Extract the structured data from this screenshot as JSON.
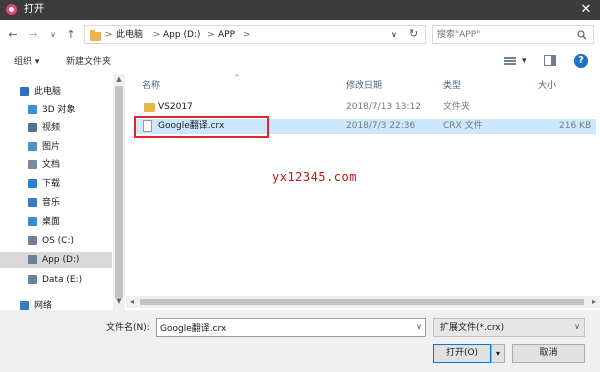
{
  "window": {
    "title": "打开",
    "close_glyph": "✕"
  },
  "nav": {
    "back": "←",
    "forward": "→",
    "recent": "∨",
    "up": "↑"
  },
  "breadcrumb": {
    "items": [
      "此电脑",
      "App (D:)",
      "APP"
    ],
    "separator": ">"
  },
  "address": {
    "dropdown": "∨",
    "refresh": "↻"
  },
  "search": {
    "placeholder": "搜索\"APP\""
  },
  "toolbar": {
    "organize": "组织 ▾",
    "new_folder": "新建文件夹",
    "view_dropdown": "▾",
    "help": "?"
  },
  "sidebar": {
    "items": [
      {
        "label": "此电脑",
        "icon": "computer-icon",
        "color": "#2d6fbf"
      },
      {
        "label": "3D 对象",
        "icon": "cube-icon",
        "color": "#3a8fd8"
      },
      {
        "label": "视频",
        "icon": "video-icon",
        "color": "#5a6f8c"
      },
      {
        "label": "图片",
        "icon": "picture-icon",
        "color": "#4e8fc7"
      },
      {
        "label": "文档",
        "icon": "document-icon",
        "color": "#7c8a99"
      },
      {
        "label": "下载",
        "icon": "download-icon",
        "color": "#2f7fd2"
      },
      {
        "label": "音乐",
        "icon": "music-icon",
        "color": "#3a7cc4"
      },
      {
        "label": "桌面",
        "icon": "desktop-icon",
        "color": "#3c8ad6"
      },
      {
        "label": "OS (C:)",
        "icon": "drive-icon",
        "color": "#6f7f94"
      },
      {
        "label": "App (D:)",
        "icon": "drive-icon",
        "color": "#6f7f94",
        "selected": true
      },
      {
        "label": "Data (E:)",
        "icon": "drive-icon",
        "color": "#6f7f94"
      },
      {
        "label": "网络",
        "icon": "network-icon",
        "color": "#3a7cc4"
      }
    ]
  },
  "columns": {
    "name": "名称",
    "modified": "修改日期",
    "type": "类型",
    "size": "大小"
  },
  "files": [
    {
      "name": "VS2017",
      "modified": "2018/7/13 13:12",
      "type": "文件夹",
      "size": "",
      "kind": "folder"
    },
    {
      "name": "Google翻译.crx",
      "modified": "2018/7/3 22:36",
      "type": "CRX 文件",
      "size": "216 KB",
      "kind": "file",
      "selected": true
    }
  ],
  "watermark": "yx12345.com",
  "filename": {
    "label": "文件名(N):",
    "value": "Google翻译.crx"
  },
  "filetype": {
    "value": "扩展文件(*.crx)"
  },
  "buttons": {
    "open": "打开(O)",
    "open_dropdown": "▾",
    "cancel": "取消"
  },
  "colors": {
    "accent": "#0078d7",
    "selection": "#cce8ff",
    "highlight": "#e0252d",
    "watermark": "#c0180c"
  }
}
